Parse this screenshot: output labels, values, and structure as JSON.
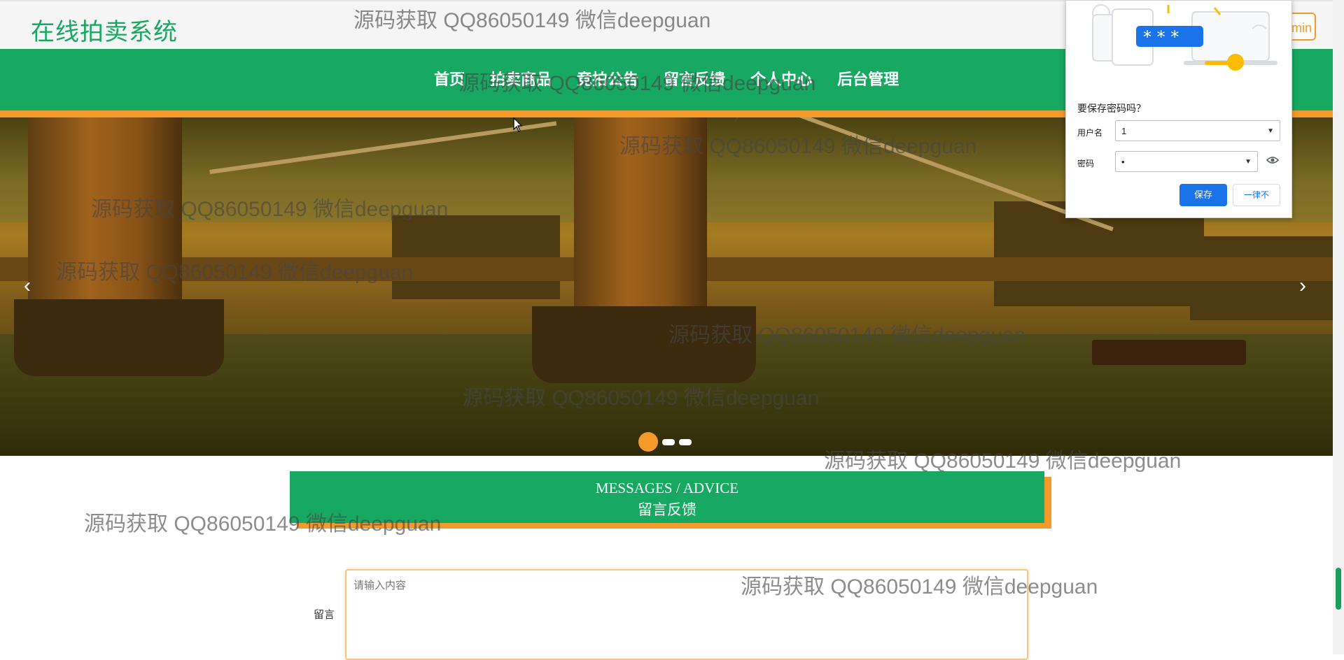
{
  "header": {
    "site_title": "在线拍卖系统",
    "admin_label": "min"
  },
  "nav": {
    "items": [
      {
        "label": "首页"
      },
      {
        "label": "拍卖商品"
      },
      {
        "label": "竞拍公告"
      },
      {
        "label": "留言反馈"
      },
      {
        "label": "个人中心"
      },
      {
        "label": "后台管理"
      }
    ]
  },
  "carousel": {
    "prev_arrow": "‹",
    "next_arrow": "›",
    "slide_count": 3,
    "active_index": 0
  },
  "section": {
    "title_en": "MESSAGES / ADVICE",
    "title_cn": "留言反馈"
  },
  "form": {
    "message_label": "留言",
    "message_placeholder": "请输入内容",
    "message_value": ""
  },
  "watermark_text": "源码获取 QQ86050149 微信deepguan",
  "password_popup": {
    "question": "要保存密码吗？",
    "username_label": "用户名",
    "username_value": "1",
    "password_label": "密码",
    "password_value": "•",
    "save_label": "保存",
    "never_label": "一律不",
    "illustration_stars": "* * *"
  },
  "colors": {
    "brand_green": "#17a861",
    "accent_orange": "#f39a2b",
    "chrome_blue": "#1a73e8"
  }
}
